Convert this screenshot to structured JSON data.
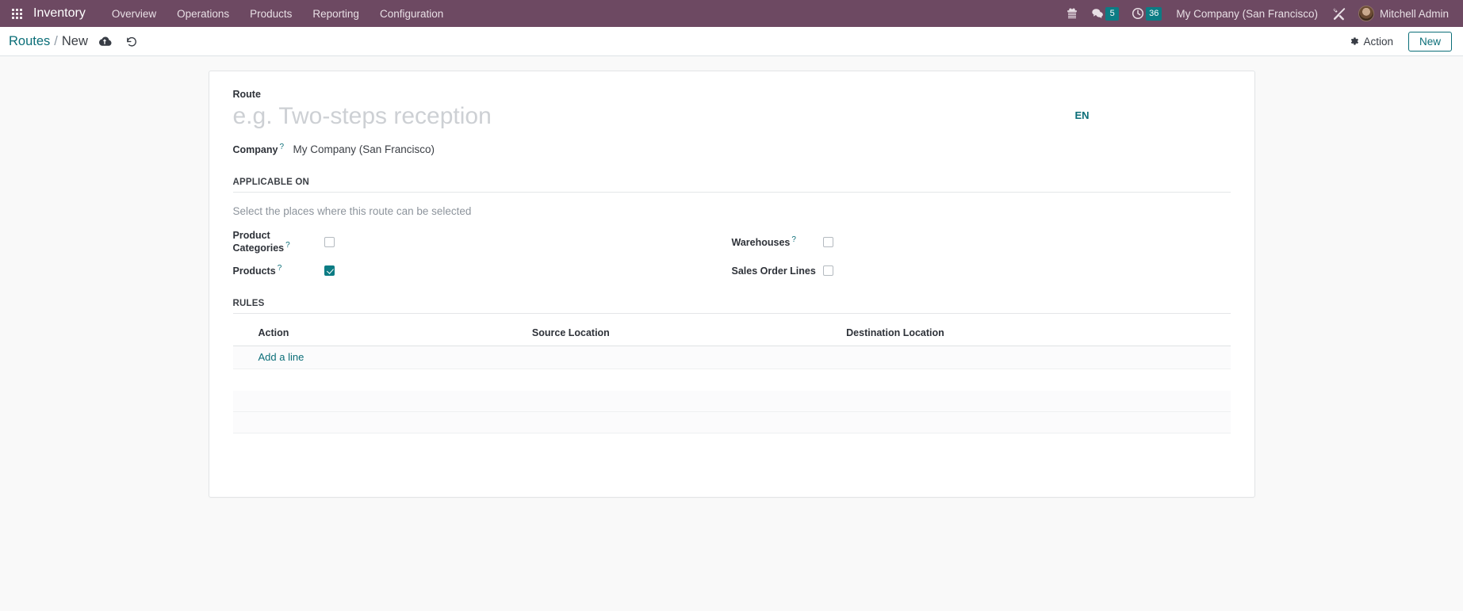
{
  "navbar": {
    "apps_icon": "apps-grid-icon",
    "brand": "Inventory",
    "menu": [
      {
        "label": "Overview"
      },
      {
        "label": "Operations"
      },
      {
        "label": "Products"
      },
      {
        "label": "Reporting"
      },
      {
        "label": "Configuration"
      }
    ],
    "systray": {
      "gift_icon": "gift-icon",
      "messages_icon": "chat-bubble-icon",
      "messages_count": "5",
      "activities_icon": "clock-icon",
      "activities_count": "36",
      "company": "My Company (San Francisco)",
      "tools_icon": "wrench-screwdriver-icon",
      "avatar": "user-avatar",
      "user": "Mitchell Admin"
    }
  },
  "control_panel": {
    "breadcrumb_parent": "Routes",
    "breadcrumb_sep": "/",
    "breadcrumb_current": "New",
    "save_icon": "cloud-upload-icon",
    "discard_icon": "undo-icon",
    "action_icon": "gear-icon",
    "action_label": "Action",
    "new_label": "New"
  },
  "form": {
    "route": {
      "label": "Route",
      "value": "",
      "placeholder": "e.g. Two-steps reception"
    },
    "language_badge": "EN",
    "company": {
      "label": "Company",
      "help": "?",
      "value": "My Company (San Francisco)"
    },
    "applicable_on": {
      "title": "APPLICABLE ON",
      "subtext": "Select the places where this route can be selected",
      "checkboxes": [
        {
          "label": "Product Categories",
          "help": "?",
          "checked": false
        },
        {
          "label": "Warehouses",
          "help": "?",
          "checked": false
        },
        {
          "label": "Products",
          "help": "?",
          "checked": true
        },
        {
          "label": "Sales Order Lines",
          "help": "",
          "checked": false
        }
      ]
    },
    "rules": {
      "title": "RULES",
      "columns": [
        "Action",
        "Source Location",
        "Destination Location"
      ],
      "rows": [],
      "add_line_label": "Add a line"
    }
  },
  "colors": {
    "navbar_bg": "#6d4962",
    "accent_teal": "#0b6e78",
    "badge_teal": "#0c7c84",
    "content_bg": "#f9f9f9"
  }
}
